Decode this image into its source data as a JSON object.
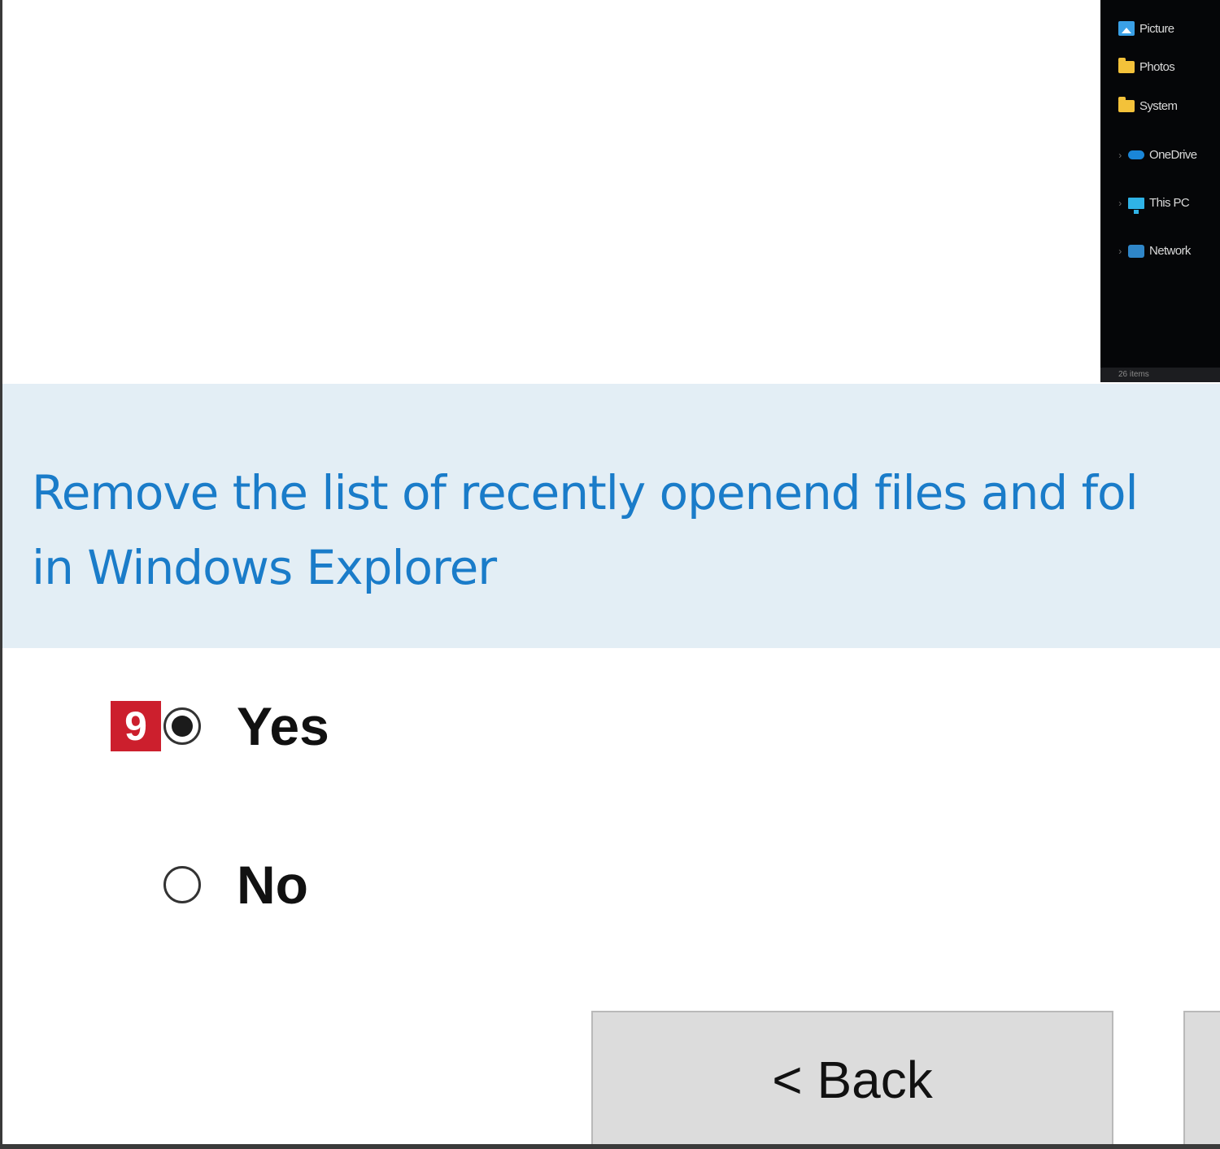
{
  "explorer_preview": {
    "items": [
      {
        "label": "Picture",
        "icon": "pictures-icon",
        "chevron": ""
      },
      {
        "label": "Photos",
        "icon": "folder-icon",
        "chevron": ""
      },
      {
        "label": "System",
        "icon": "folder-icon",
        "chevron": ""
      },
      {
        "label": "OneDrive",
        "icon": "onedrive-icon",
        "chevron": "›"
      },
      {
        "label": "This PC",
        "icon": "pc-icon",
        "chevron": "›"
      },
      {
        "label": "Network",
        "icon": "network-icon",
        "chevron": "›"
      }
    ],
    "status": "26 items"
  },
  "setting": {
    "description_line1": "Remove the list of recently openend files and fol",
    "description_line2": "in Windows Explorer"
  },
  "step_badge": "9",
  "options": {
    "yes_label": "Yes",
    "no_label": "No",
    "selected": "yes"
  },
  "buttons": {
    "back_label": "< Back"
  },
  "colors": {
    "description_text": "#1a7cc9",
    "description_band": "#e3eef5",
    "badge": "#cc1f2d",
    "button_face": "#dcdcdc"
  }
}
